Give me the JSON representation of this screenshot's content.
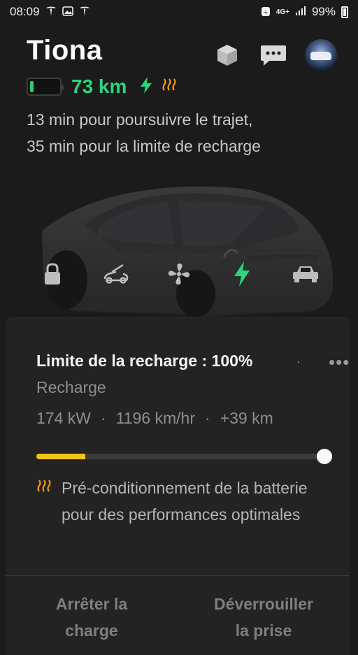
{
  "status_bar": {
    "time": "08:09",
    "network": "4G+",
    "battery": "99%"
  },
  "header": {
    "car_name": "Tiona",
    "icons": [
      "box-icon",
      "chat-icon",
      "avatar"
    ]
  },
  "range": {
    "value": "73 km",
    "battery_level_fraction": 0.08,
    "charging_icon": "bolt-icon",
    "heat_icon": "battery-heat-icon"
  },
  "eta": {
    "line1": "13 min pour poursuivre le trajet,",
    "line2": "35 min pour la limite de recharge"
  },
  "car_controls": [
    "lock-icon",
    "frunk-icon",
    "fan-icon",
    "charge-bolt-icon",
    "car-icon"
  ],
  "charging": {
    "limit_label": "Limite de la recharge : 100%",
    "limit_dot": "·",
    "more": "•••",
    "status": "Recharge",
    "power": "174 kW",
    "rate": "1196 km/hr",
    "added": "+39 km",
    "separator": "·",
    "progress_fraction": 0.17,
    "limit_fraction": 1.0,
    "precondition_text": "Pré-conditionnement de la batterie pour des performances optimales"
  },
  "actions": {
    "stop": "Arrêter la\ncharge",
    "unlock": "Déverrouiller\nla prise"
  },
  "colors": {
    "background": "#1b1b1c",
    "range_green": "#2bd67b",
    "charge_yellow": "#f0c419",
    "heat_orange": "#f39c12"
  }
}
